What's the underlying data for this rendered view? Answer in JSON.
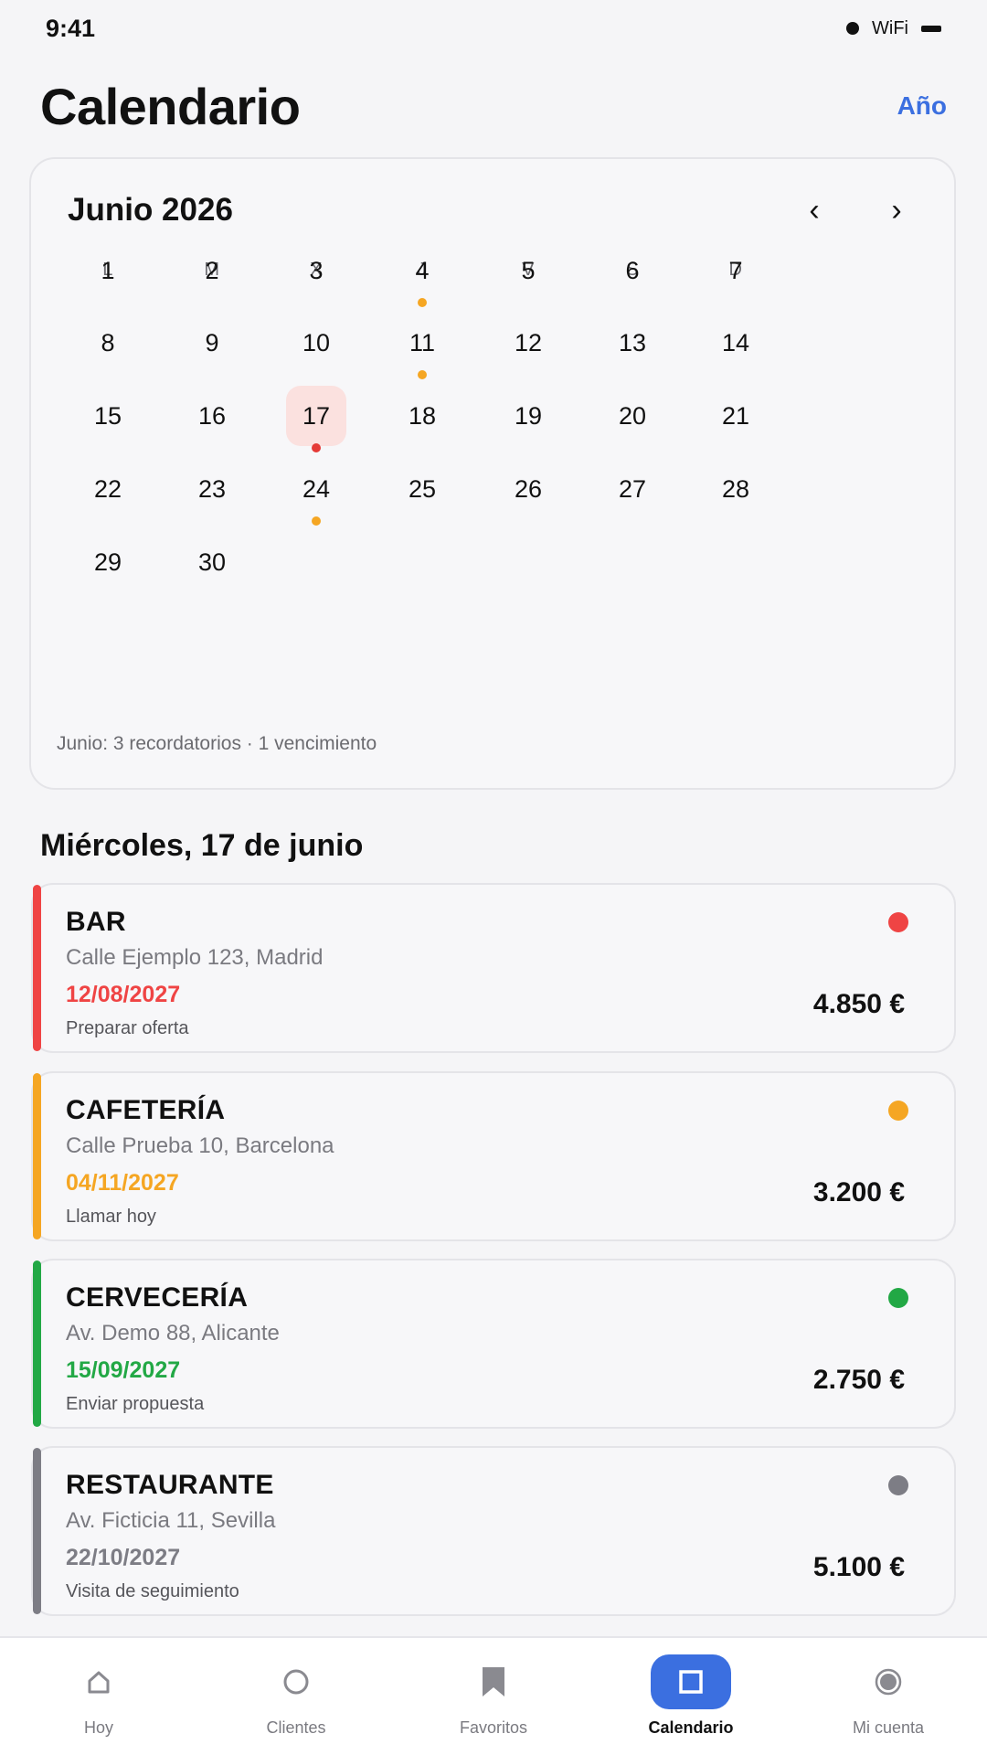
{
  "status_bar": {
    "time": "9:41",
    "wifi": "WiFi"
  },
  "header": {
    "title": "Calendario",
    "year_link": "Año"
  },
  "calendar": {
    "month_title": "Junio 2026",
    "prev_icon": "chevron-left-icon",
    "next_icon": "chevron-right-icon",
    "prev_glyph": "‹",
    "next_glyph": "›",
    "weekdays": [
      "L",
      "M",
      "X",
      "J",
      "V",
      "S",
      "D"
    ],
    "first_weekday_index": 0,
    "days_in_month": 30,
    "selected_day": 17,
    "markers": [
      {
        "day": 4,
        "color": "#f5a623"
      },
      {
        "day": 11,
        "color": "#f5a623"
      },
      {
        "day": 17,
        "color": "#e53935"
      },
      {
        "day": 24,
        "color": "#f5a623"
      }
    ],
    "summary": "Junio: 3 recordatorios · 1 vencimiento"
  },
  "day_heading": "Miércoles, 17 de junio",
  "items": [
    {
      "title": "BAR",
      "address": "Calle Ejemplo 123, Madrid",
      "date": "12/08/2027",
      "note": "Preparar oferta",
      "amount": "4.850 €",
      "color": "#ef4444"
    },
    {
      "title": "CAFETERÍA",
      "address": "Calle Prueba 10, Barcelona",
      "date": "04/11/2027",
      "note": "Llamar hoy",
      "amount": "3.200 €",
      "color": "#f5a623"
    },
    {
      "title": "CERVECERÍA",
      "address": "Av. Demo 88, Alicante",
      "date": "15/09/2027",
      "note": "Enviar propuesta",
      "amount": "2.750 €",
      "color": "#22a845"
    },
    {
      "title": "RESTAURANTE",
      "address": "Av. Ficticia 11, Sevilla",
      "date": "22/10/2027",
      "note": "Visita de seguimiento",
      "amount": "5.100 €",
      "color": "#7d7d85"
    }
  ],
  "bottom_nav": [
    {
      "label": "Hoy",
      "icon": "home-icon",
      "active": false
    },
    {
      "label": "Clientes",
      "icon": "circle-icon",
      "active": false
    },
    {
      "label": "Favoritos",
      "icon": "bookmark-icon",
      "active": false
    },
    {
      "label": "Calendario",
      "icon": "calendar-square-icon",
      "active": true
    },
    {
      "label": "Mi cuenta",
      "icon": "account-icon",
      "active": false
    }
  ],
  "colors": {
    "accent": "#3b6fe0",
    "selected_day_bg": "#fbe1df"
  }
}
